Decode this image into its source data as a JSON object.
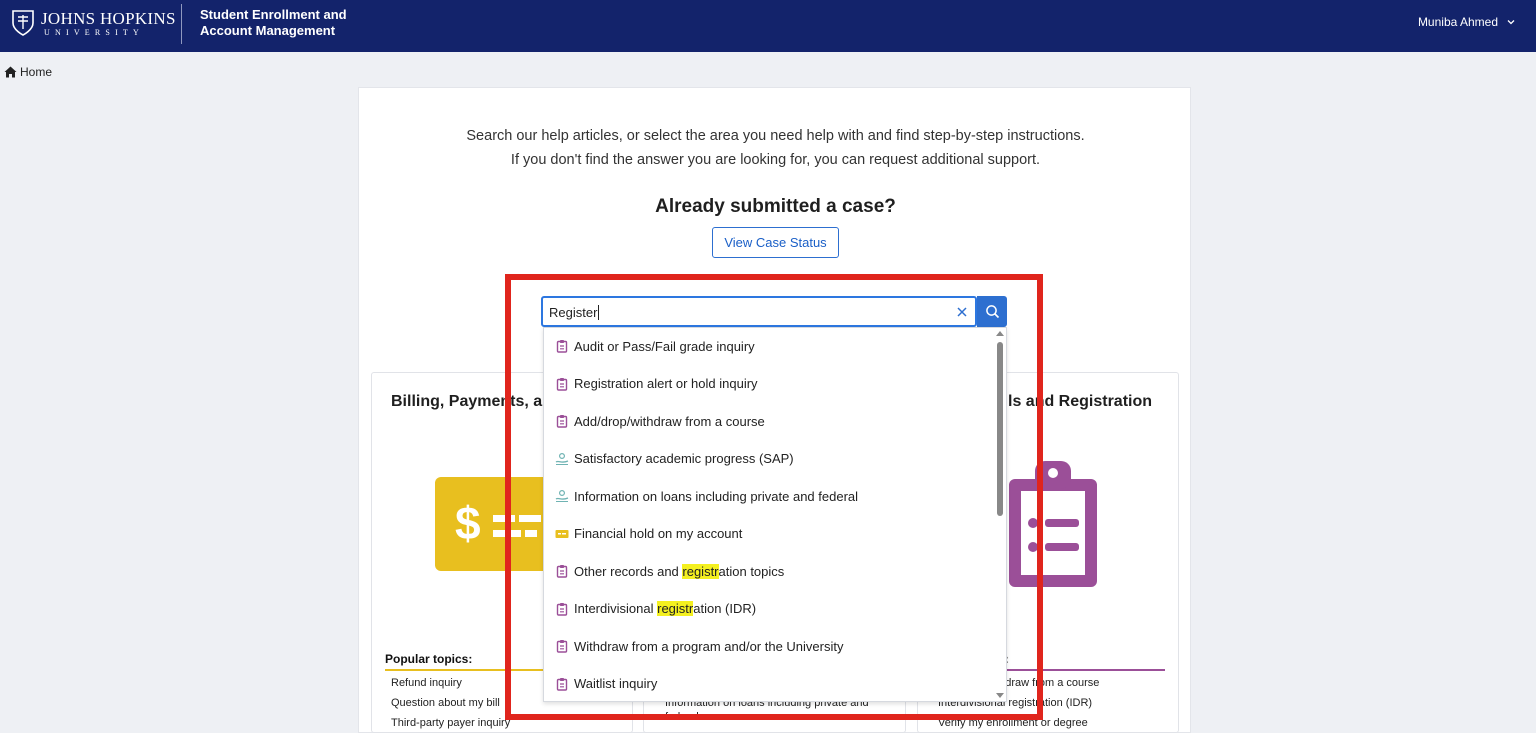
{
  "header": {
    "logo_main": "JOHNS HOPKINS",
    "logo_sub": "UNIVERSITY",
    "app_title": "Student Enrollment and Account Management",
    "user_name": "Muniba Ahmed"
  },
  "breadcrumb": {
    "home_label": "Home"
  },
  "intro": {
    "line1": "Search our help articles, or select the area you need help with and find step-by-step instructions.",
    "line2": "If you don't find the answer you are looking for, you can request additional support."
  },
  "case": {
    "heading": "Already submitted a case?",
    "button_label": "View Case Status"
  },
  "search": {
    "value": "Register",
    "clear_icon": "close-icon",
    "search_icon": "search-icon"
  },
  "dropdown": {
    "items": [
      {
        "icon": "clipboard-icon",
        "pre": "Audit or Pass/Fail grade inquiry",
        "match": "",
        "post": ""
      },
      {
        "icon": "clipboard-icon",
        "pre": "Registration alert or hold inquiry",
        "match": "",
        "post": ""
      },
      {
        "icon": "clipboard-icon",
        "pre": "Add/drop/withdraw from a course",
        "match": "",
        "post": ""
      },
      {
        "icon": "money-hand-icon",
        "pre": "Satisfactory academic progress (SAP)",
        "match": "",
        "post": ""
      },
      {
        "icon": "money-hand-icon",
        "pre": "Information on loans including private and federal",
        "match": "",
        "post": ""
      },
      {
        "icon": "bill-icon",
        "pre": "Financial hold on my account",
        "match": "",
        "post": ""
      },
      {
        "icon": "clipboard-icon",
        "pre": "Other records and ",
        "match": "registr",
        "post": "ation topics"
      },
      {
        "icon": "clipboard-icon",
        "pre": "Interdivisional ",
        "match": "registr",
        "post": "ation (IDR)"
      },
      {
        "icon": "clipboard-icon",
        "pre": "Withdraw from a program and/or the University",
        "match": "",
        "post": ""
      },
      {
        "icon": "clipboard-icon",
        "pre": "Waitlist inquiry",
        "match": "",
        "post": ""
      }
    ]
  },
  "categories": {
    "billing": {
      "title": "Billing, Payments, and",
      "topics_heading": "Popular topics:",
      "topics": [
        "Refund inquiry",
        "Question about my bill",
        "Third-party payer inquiry"
      ]
    },
    "financial_aid": {
      "topics": [
        "Information on loans including private and",
        "federal"
      ]
    },
    "records": {
      "title": "Records and Registration",
      "title_visible": "ls and Registration",
      "topics_heading": "s:",
      "topics": [
        "Add/drop/withdraw from a course",
        "Interdivisional registration (IDR)",
        "Verify my enrollment or degree"
      ]
    }
  },
  "colors": {
    "header_bg": "#13236b",
    "accent_blue": "#2d6fd0",
    "billing_yellow": "#e8bf1f",
    "records_purple": "#9b4f98",
    "highlight_yellow": "#f4f020",
    "annotation_red": "#e0251d"
  }
}
